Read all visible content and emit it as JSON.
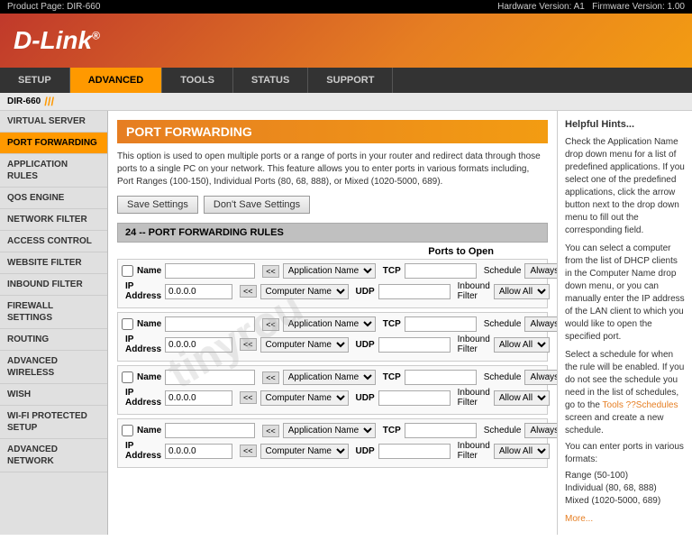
{
  "topbar": {
    "product": "Product Page: DIR-660",
    "hardware": "Hardware Version: A1",
    "firmware": "Firmware Version: 1.00"
  },
  "header": {
    "logo": "D-Link"
  },
  "nav": {
    "tabs": [
      {
        "id": "setup",
        "label": "SETUP",
        "active": false
      },
      {
        "id": "advanced",
        "label": "ADVANCED",
        "active": true
      },
      {
        "id": "tools",
        "label": "TOOLS",
        "active": false
      },
      {
        "id": "status",
        "label": "STATUS",
        "active": false
      },
      {
        "id": "support",
        "label": "SUPPORT",
        "active": false
      }
    ]
  },
  "device": {
    "name": "DIR-660",
    "separator": "///"
  },
  "sidebar": {
    "items": [
      {
        "id": "virtual-server",
        "label": "VIRTUAL SERVER",
        "active": false
      },
      {
        "id": "port-forwarding",
        "label": "PORT FORWARDING",
        "active": true
      },
      {
        "id": "application-rules",
        "label": "APPLICATION RULES",
        "active": false
      },
      {
        "id": "qos-engine",
        "label": "QOS ENGINE",
        "active": false
      },
      {
        "id": "network-filter",
        "label": "NETWORK FILTER",
        "active": false
      },
      {
        "id": "access-control",
        "label": "ACCESS CONTROL",
        "active": false
      },
      {
        "id": "website-filter",
        "label": "WEBSITE FILTER",
        "active": false
      },
      {
        "id": "inbound-filter",
        "label": "INBOUND FILTER",
        "active": false
      },
      {
        "id": "firewall-settings",
        "label": "FIREWALL SETTINGS",
        "active": false
      },
      {
        "id": "routing",
        "label": "ROUTING",
        "active": false
      },
      {
        "id": "advanced-wireless",
        "label": "ADVANCED WIRELESS",
        "active": false
      },
      {
        "id": "wish",
        "label": "WISH",
        "active": false
      },
      {
        "id": "wi-fi-protected",
        "label": "WI-FI PROTECTED SETUP",
        "active": false
      },
      {
        "id": "advanced-network",
        "label": "ADVANCED NETWORK",
        "active": false
      }
    ]
  },
  "page": {
    "title": "PORT FORWARDING",
    "description": "This option is used to open multiple ports or a range of ports in your router and redirect data through those ports to a single PC on your network. This feature allows you to enter ports in various formats including, Port Ranges (100-150), Individual Ports (80, 68, 888), or Mixed (1020-5000, 689).",
    "save_btn": "Save Settings",
    "dont_save_btn": "Don't Save Settings",
    "rules_header": "24 -- PORT FORWARDING RULES",
    "ports_label": "Ports to Open",
    "labels": {
      "name": "Name",
      "ip_address": "IP Address",
      "tcp": "TCP",
      "udp": "UDP",
      "schedule": "Schedule",
      "inbound_filter": "Inbound Filter",
      "always": "Always",
      "allow_all": "Allow All"
    },
    "rules": [
      {
        "name": "",
        "ip": "0.0.0.0",
        "app_name": "Application Name",
        "computer_name": "Computer Name",
        "tcp": "",
        "udp": "",
        "schedule": "Always",
        "inbound": "Allow All"
      },
      {
        "name": "",
        "ip": "0.0.0.0",
        "app_name": "Application Name",
        "computer_name": "Computer Name",
        "tcp": "",
        "udp": "",
        "schedule": "Always",
        "inbound": "Allow All"
      },
      {
        "name": "",
        "ip": "0.0.0.0",
        "app_name": "Application Name",
        "computer_name": "Computer Name",
        "tcp": "",
        "udp": "",
        "schedule": "Always",
        "inbound": "Allow All"
      },
      {
        "name": "",
        "ip": "0.0.0.0",
        "app_name": "Application Name",
        "computer_name": "Computer Name",
        "tcp": "",
        "udp": "",
        "schedule": "Always",
        "inbound": "Allow All"
      }
    ]
  },
  "help": {
    "title": "Helpful Hints...",
    "text1": "Check the Application Name drop down menu for a list of predefined applications. If you select one of the predefined applications, click the arrow button next to the drop down menu to fill out the corresponding field.",
    "text2": "You can select a computer from the list of DHCP clients in the Computer Name drop down menu, or you can manually enter the IP address of the LAN client to which you would like to open the specified port.",
    "text3": "Select a schedule for when the rule will be enabled. If you do not see the schedule you need in the list of schedules, go to the",
    "tools_link": "Tools ??Schedules",
    "text4": "screen and create a new schedule.",
    "text5": "You can enter ports in various formats:",
    "range": "Range (50-100)",
    "individual": "Individual (80, 68, 888)",
    "mixed": "Mixed (1020-5000, 689)",
    "more_link": "More..."
  }
}
